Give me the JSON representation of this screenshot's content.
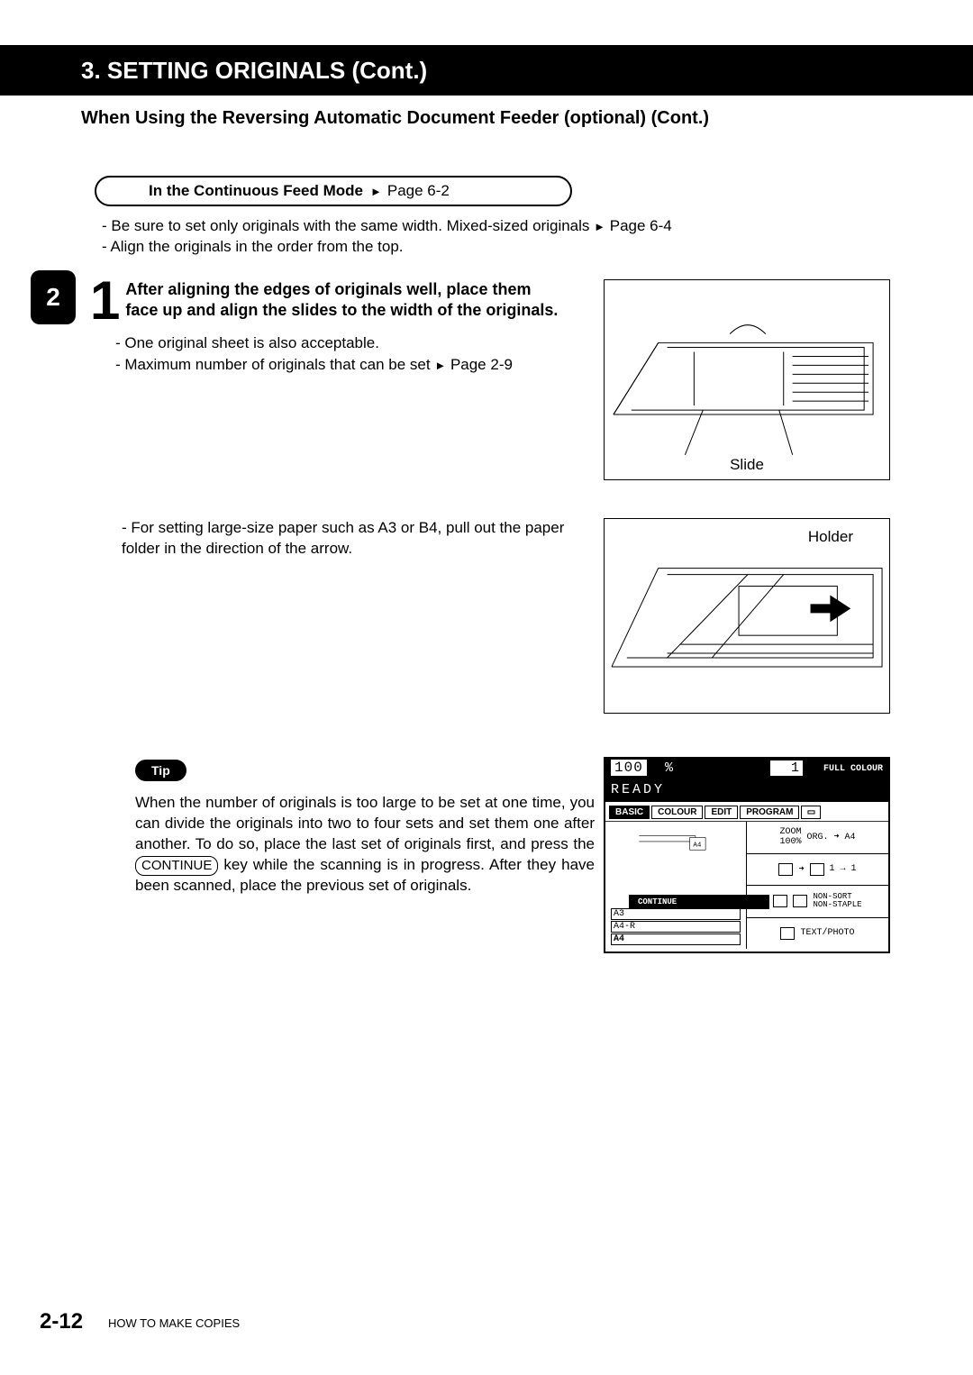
{
  "header": "3.  SETTING  ORIGINALS (Cont.)",
  "subhead": "When Using the Reversing Automatic Document Feeder (optional) (Cont.)",
  "mode": {
    "title": "In the Continuous Feed Mode",
    "page_ref": "Page 6-2"
  },
  "intro_notes": {
    "line1_a": "-  Be sure to set only originals with the same width. Mixed-sized originals  ",
    "line1_ref": " Page 6-4",
    "line2": "-  Align the originals in the order from the top."
  },
  "side_tab": "2",
  "step1": {
    "num": "1",
    "bold": "After aligning the edges of originals well, place them face up and align the slides to the width of the originals.",
    "sub1": "-  One original sheet  is also acceptable.",
    "sub2_a": "-  Maximum number of originals that can be set ",
    "sub2_ref": " Page 2-9",
    "fig1_label": "Slide"
  },
  "sub_large": "-  For setting large-size paper such as A3 or B4, pull out the paper folder in the direction of the arrow.",
  "fig2_label": "Holder",
  "tip": {
    "badge": "Tip",
    "text_a": "When the number of originals is too large to be set at one time, you can divide the originals into two to four sets and set them one after another. To do so, place the last set of originals first, and press the ",
    "key": "CONTINUE",
    "text_b": " key while the scanning is in progress.  After they have been scanned, place the previous set of originals."
  },
  "lcd": {
    "zoom": "100",
    "pct": "%",
    "count": "1",
    "fullcolour": "FULL COLOUR",
    "ready": "READY",
    "tabs": [
      "BASIC",
      "COLOUR",
      "EDIT",
      "PROGRAM"
    ],
    "trays": [
      "A3",
      "A4-R",
      "A4"
    ],
    "tray_sel": "A4",
    "continue": "CONTINUE",
    "r1a": "ZOOM",
    "r1b": "ORG. ➜  A4",
    "r1c": "100%",
    "r2": "1  →  1",
    "r3": "NON-SORT\nNON-STAPLE",
    "r4": "TEXT/PHOTO"
  },
  "page_num": "2-12",
  "page_foot": "HOW TO MAKE COPIES"
}
